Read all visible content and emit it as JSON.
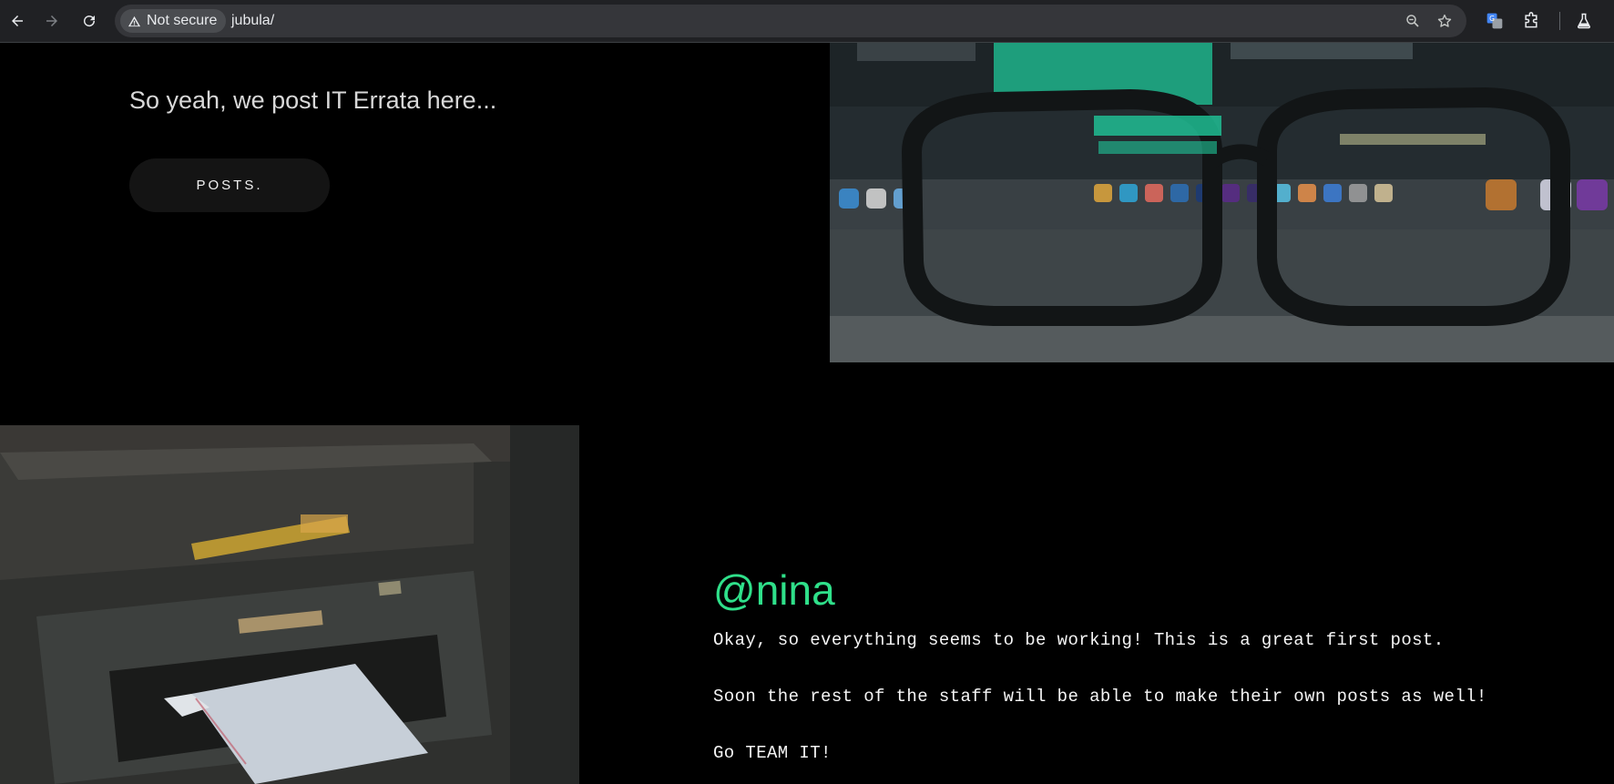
{
  "browser": {
    "security_label": "Not secure",
    "url": "jubula/",
    "icons": {
      "back": "back-arrow-icon",
      "forward": "forward-arrow-icon",
      "reload": "reload-icon",
      "warning": "warning-triangle-icon",
      "zoom": "zoom-icon",
      "bookmark": "star-icon",
      "translate": "translate-extension-icon",
      "extensions": "puzzle-icon",
      "labs": "flask-icon"
    }
  },
  "hero": {
    "subtitle": "So yeah, we post IT Errata here...",
    "button_label": "POSTS."
  },
  "post": {
    "author": "@nina",
    "paragraphs": [
      "Okay, so everything seems to be working! This is a great first post.",
      "Soon the rest of the staff will be able to make their own posts as well!",
      "Go TEAM IT!"
    ]
  },
  "colors": {
    "accent": "#2fe08a",
    "background": "#000000",
    "button_bg": "#141414",
    "chrome_bg": "#202124"
  }
}
